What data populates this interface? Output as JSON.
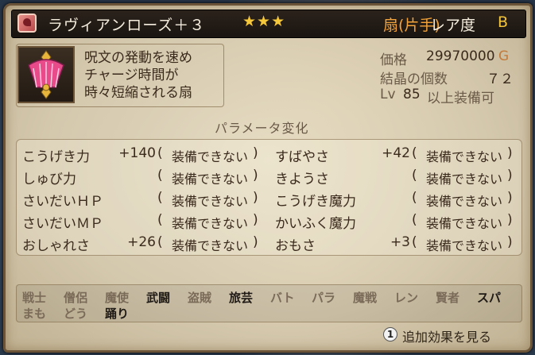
{
  "item": {
    "name": "ラヴィアンローズ＋３",
    "stars": "★★★",
    "type": "扇(片手)",
    "rarity_label": "レア度",
    "rarity": "B",
    "icon": "pink-fan-icon",
    "category_icon": "fan-category-icon"
  },
  "description": [
    "呪文の発動を速め",
    "チャージ時間が",
    "時々短縮される扇"
  ],
  "stats": {
    "price_label": "価格",
    "price_value": "29970000",
    "price_unit": "G",
    "crystal_label": "結晶の個数",
    "crystal_value": "７２",
    "level_label": "Lv",
    "level_value": "85",
    "level_suffix": "以上装備可"
  },
  "params_title": "パラメータ変化",
  "params_left": [
    {
      "name": "こうげき力",
      "value": "+140",
      "status": "装備できない"
    },
    {
      "name": "しゅび力",
      "value": "",
      "status": "装備できない"
    },
    {
      "name": "さいだいＨＰ",
      "value": "",
      "status": "装備できない"
    },
    {
      "name": "さいだいＭＰ",
      "value": "",
      "status": "装備できない"
    },
    {
      "name": "おしゃれさ",
      "value": "+26",
      "status": "装備できない"
    }
  ],
  "params_right": [
    {
      "name": "すばやさ",
      "value": "+42",
      "status": "装備できない"
    },
    {
      "name": "きようさ",
      "value": "",
      "status": "装備できない"
    },
    {
      "name": "こうげき魔力",
      "value": "",
      "status": "装備できない"
    },
    {
      "name": "かいふく魔力",
      "value": "",
      "status": "装備できない"
    },
    {
      "name": "おもさ",
      "value": "+3",
      "status": "装備できない"
    }
  ],
  "jobs_row1": [
    {
      "label": "戦士",
      "active": false
    },
    {
      "label": "僧侶",
      "active": false
    },
    {
      "label": "魔使",
      "active": false
    },
    {
      "label": "武闘",
      "active": true
    },
    {
      "label": "盗賊",
      "active": false
    },
    {
      "label": "旅芸",
      "active": true
    },
    {
      "label": "バト",
      "active": false
    },
    {
      "label": "パラ",
      "active": false
    },
    {
      "label": "魔戦",
      "active": false
    },
    {
      "label": "レン",
      "active": false
    },
    {
      "label": "賢者",
      "active": false
    },
    {
      "label": "スパ",
      "active": true
    }
  ],
  "jobs_row2": [
    {
      "label": "まも",
      "active": false
    },
    {
      "label": "どう",
      "active": false
    },
    {
      "label": "踊り",
      "active": true
    }
  ],
  "footer": {
    "button_glyph": "1",
    "button_label": "追加効果を見る"
  }
}
